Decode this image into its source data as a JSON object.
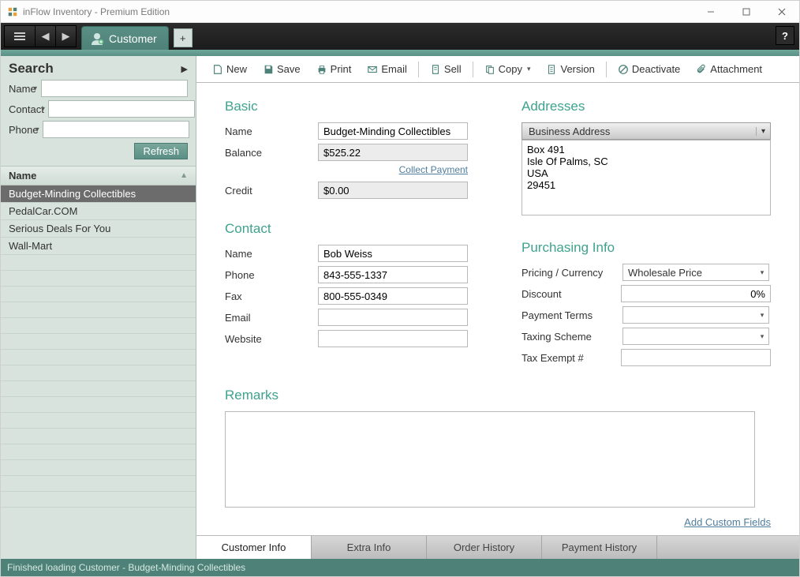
{
  "window": {
    "title": "inFlow Inventory - Premium Edition"
  },
  "tab": {
    "label": "Customer"
  },
  "sidebar": {
    "search_label": "Search",
    "fields": {
      "name": "Name",
      "contact": "Contact",
      "phone": "Phone"
    },
    "refresh": "Refresh",
    "list_header": "Name",
    "items": [
      "Budget-Minding Collectibles",
      "PedalCar.COM",
      "Serious Deals For You",
      "Wall-Mart"
    ]
  },
  "toolbar": {
    "new": "New",
    "save": "Save",
    "print": "Print",
    "email": "Email",
    "sell": "Sell",
    "copy": "Copy",
    "version": "Version",
    "deactivate": "Deactivate",
    "attachment": "Attachment"
  },
  "sections": {
    "basic": "Basic",
    "addresses": "Addresses",
    "contact": "Contact",
    "purch": "Purchasing Info",
    "remarks": "Remarks"
  },
  "basic": {
    "name_label": "Name",
    "name": "Budget-Minding Collectibles",
    "balance_label": "Balance",
    "balance": "$525.22",
    "collect_link": "Collect Payment",
    "credit_label": "Credit",
    "credit": "$0.00"
  },
  "addresses": {
    "selected": "Business Address",
    "text": "Box 491\nIsle Of Palms, SC\nUSA\n29451"
  },
  "contact": {
    "name_label": "Name",
    "name": "Bob Weiss",
    "phone_label": "Phone",
    "phone": "843-555-1337",
    "fax_label": "Fax",
    "fax": "800-555-0349",
    "email_label": "Email",
    "email": "",
    "website_label": "Website",
    "website": ""
  },
  "purch": {
    "pricing_label": "Pricing / Currency",
    "pricing": "Wholesale Price",
    "discount_label": "Discount",
    "discount": "0%",
    "terms_label": "Payment Terms",
    "terms": "",
    "tax_label": "Taxing Scheme",
    "tax": "",
    "exempt_label": "Tax Exempt #",
    "exempt": ""
  },
  "remarks_text": "",
  "add_custom": "Add Custom Fields",
  "bottom_tabs": {
    "info": "Customer Info",
    "extra": "Extra Info",
    "order": "Order History",
    "payment": "Payment History"
  },
  "status": "Finished loading Customer - Budget-Minding Collectibles"
}
